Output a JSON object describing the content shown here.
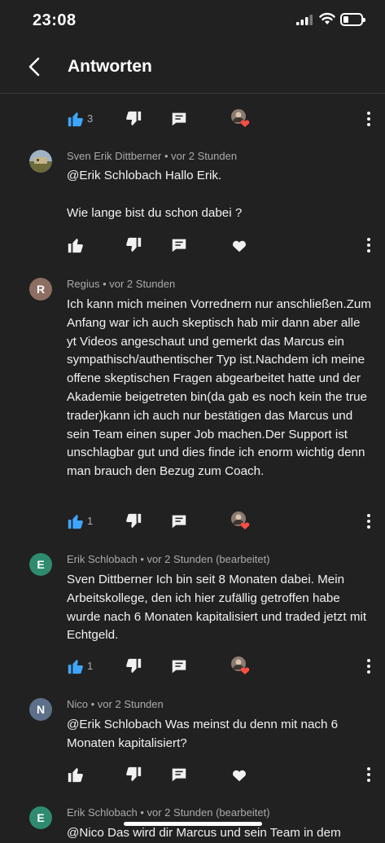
{
  "status_bar": {
    "time": "23:08",
    "icons": [
      "signal-icon",
      "wifi-icon",
      "battery-icon"
    ]
  },
  "header": {
    "title": "Antworten",
    "back_icon": "back-arrow-icon"
  },
  "colors": {
    "like_active": "#3ea6ff",
    "creator_heart": "#ff4e45",
    "background": "#212121"
  },
  "top_actions": {
    "like_count": "3",
    "liked": true,
    "creator_heart": true
  },
  "comments": [
    {
      "author": "Sven Erik Dittberner",
      "time": "• vor 2 Stunden",
      "avatar": "",
      "text": [
        "@Erik Schlobach Hallo Erik.",
        "",
        "Wie lange bist du schon dabei ?"
      ],
      "like_count": "",
      "creator_heart": false
    },
    {
      "author": "Regius",
      "time": "• vor 2 Stunden",
      "avatar": "R",
      "text": [
        "Ich kann mich meinen Vorrednern nur anschließen.Zum Anfang war ich auch skeptisch hab mir dann aber alle yt Videos angeschaut und gemerkt das Marcus ein sympathisch/authentischer Typ ist.Nachdem ich meine offene skeptischen Fragen abgearbeitet hatte und der Akademie beigetreten bin(da gab es noch kein the true trader)kann ich auch nur bestätigen das Marcus und sein Team einen super Job machen.Der Support ist unschlagbar gut und dies finde ich enorm wichtig denn man brauch den Bezug zum Coach."
      ],
      "like_count": "1",
      "creator_heart": true
    },
    {
      "author": "Erik Schlobach",
      "time": "• vor 2 Stunden (bearbeitet)",
      "avatar": "E",
      "text": [
        "Sven  Dittberner Ich bin seit 8 Monaten dabei. Mein Arbeitskollege, den ich hier zufällig getroffen habe wurde nach 6 Monaten kapitalisiert und traded jetzt mit Echtgeld."
      ],
      "like_count": "1",
      "creator_heart": true
    },
    {
      "author": "Nico",
      "time": "• vor 2 Stunden",
      "avatar": "N",
      "text": [
        "@Erik Schlobach Was meinst du denn mit nach 6 Monaten kapitalisiert?"
      ],
      "like_count": "",
      "creator_heart": false
    },
    {
      "author": "Erik Schlobach",
      "time": "• vor 2 Stunden (bearbeitet)",
      "avatar": "E",
      "text": [
        "@Nico Das wird dir Marcus und sein Team in dem"
      ],
      "like_count": "",
      "creator_heart": false
    }
  ]
}
